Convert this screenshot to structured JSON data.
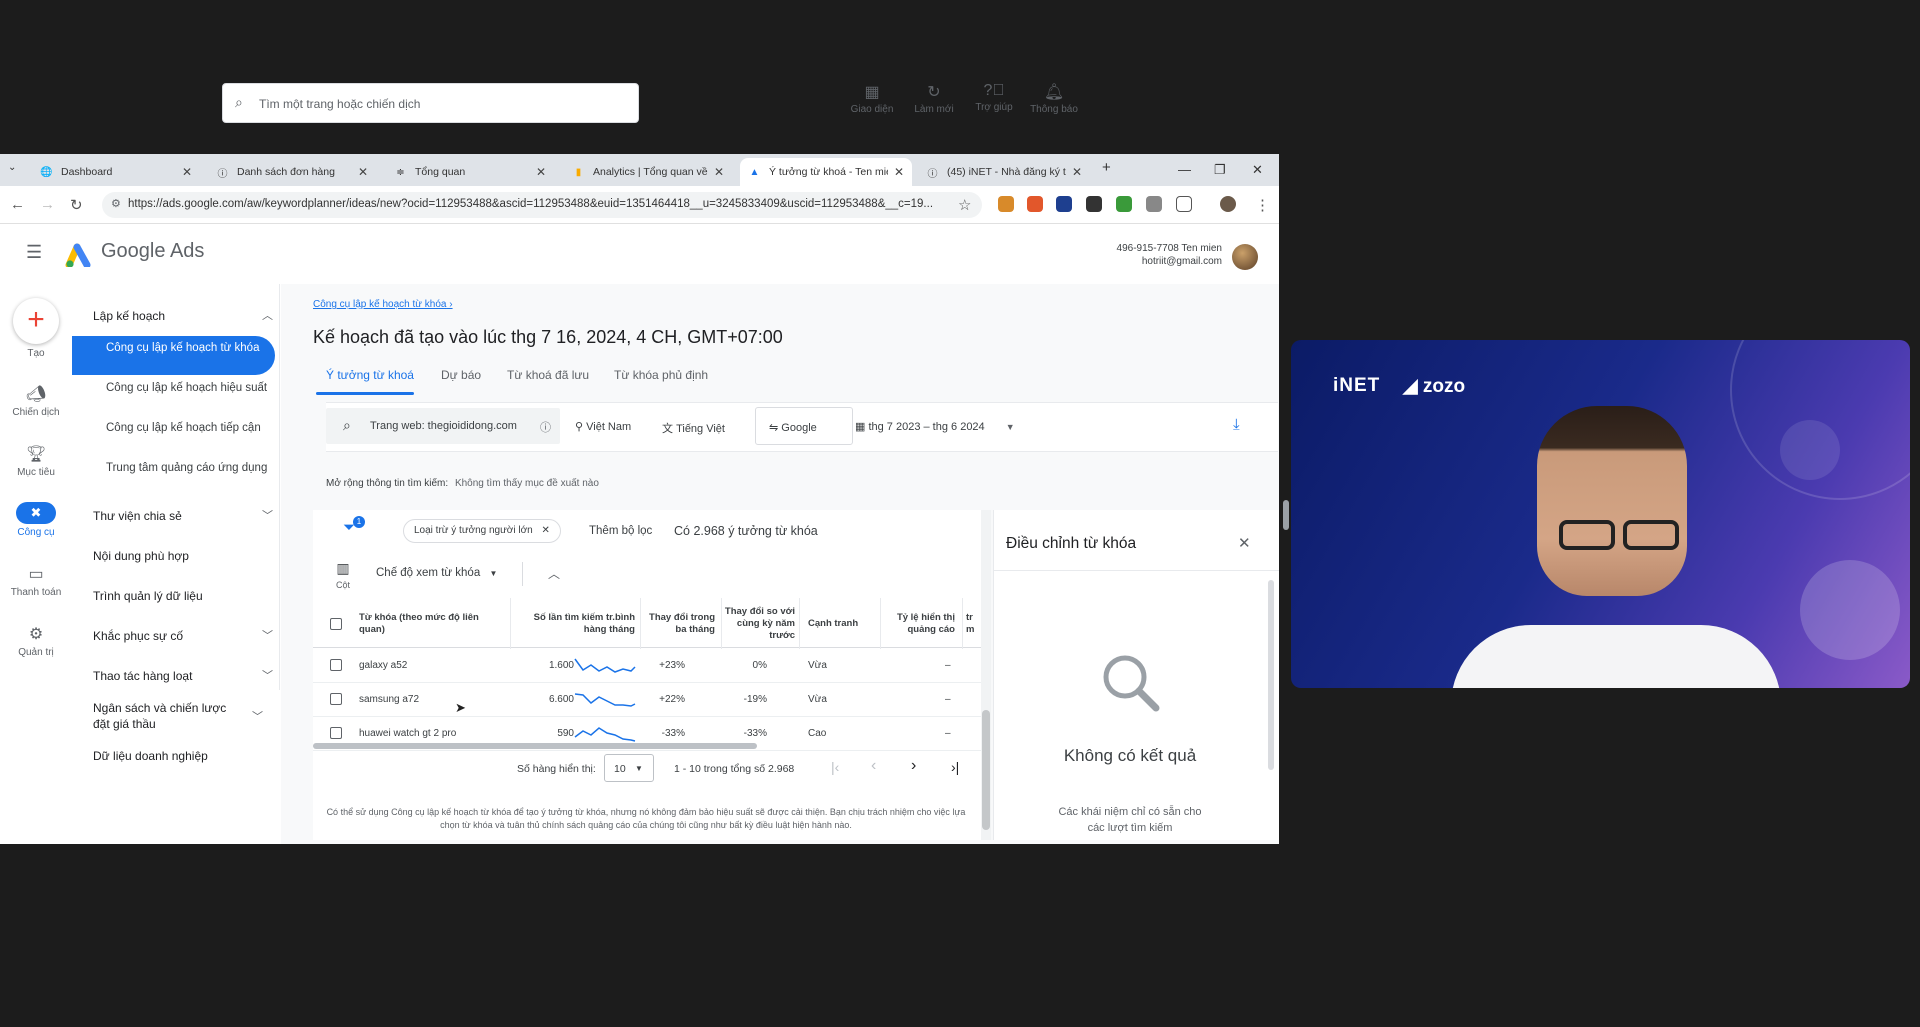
{
  "browser": {
    "tabs": [
      {
        "label": "Dashboard",
        "icon": "globe-icon"
      },
      {
        "label": "Danh sách đơn hàng",
        "icon": "info-icon"
      },
      {
        "label": "Tổng quan",
        "icon": "tune-icon"
      },
      {
        "label": "Analytics | Tổng quan về h",
        "icon": "analytics-icon"
      },
      {
        "label": "Ý tưởng từ khoá - Ten mie",
        "icon": "google-ads-icon"
      },
      {
        "label": "(45) iNET - Nhà đăng ký t",
        "icon": "info-icon"
      }
    ],
    "url": "https://ads.google.com/aw/keywordplanner/ideas/new?ocid=112953488&ascid=112953488&euid=1351464418__u=3245833409&uscid=112953488&__c=19..."
  },
  "header": {
    "product": "Google Ads",
    "search_placeholder": "Tìm một trang hoặc chiến dịch",
    "actions": [
      "Giao diện",
      "Làm mới",
      "Trợ giúp",
      "Thông báo"
    ],
    "account_id": "496-915-7708 Ten mien",
    "account_email": "hotriit@gmail.com"
  },
  "rail": [
    "Tạo",
    "Chiến dịch",
    "Mục tiêu",
    "Công cụ",
    "Thanh toán",
    "Quản trị"
  ],
  "sidenav": {
    "planning": "Lập kế hoạch",
    "sub": [
      "Công cụ lập kế hoạch từ khóa",
      "Công cụ lập kế hoạch hiệu suất",
      "Công cụ lập kế hoạch tiếp cận",
      "Trung tâm quảng cáo ứng dụng"
    ],
    "sections": [
      "Thư viện chia sẻ",
      "Nội dung phù hợp",
      "Trình quản lý dữ liệu",
      "Khắc phục sự cố",
      "Thao tác hàng loạt",
      "Ngân sách và chiến lược đặt giá thầu",
      "Dữ liệu doanh nghiệp"
    ]
  },
  "main": {
    "breadcrumb": "Công cụ lập kế hoạch từ khóa",
    "title": "Kế hoạch đã tạo vào lúc thg 7 16, 2024, 4 CH, GMT+07:00",
    "tabs": [
      "Ý tưởng từ khoá",
      "Dự báo",
      "Từ khoá đã lưu",
      "Từ khóa phủ định"
    ],
    "filters": {
      "website": "Trang web: thegioididong.com",
      "location": "Việt Nam",
      "language": "Tiếng Việt",
      "network": "Google",
      "date_range": "thg 7 2023 – thg 6 2024"
    },
    "expand_label": "Mở rộng thông tin tìm kiếm:",
    "expand_value": "Không tìm thấy mục đề xuất nào",
    "filter_badge": "1",
    "exclude_chip": "Loại trừ ý tưởng người lớn",
    "add_filter": "Thêm bộ lọc",
    "count": "Có 2.968 ý tưởng từ khóa",
    "view_mode": "Chế độ xem từ khóa",
    "columns_label": "Cột",
    "table": {
      "headers": [
        "Từ khóa (theo mức độ liên quan)",
        "Số lần tìm kiếm tr.bình hàng tháng",
        "Thay đổi trong ba tháng",
        "Thay đổi so với cùng kỳ năm trước",
        "Cạnh tranh",
        "Tỷ lệ hiển thị quảng cáo",
        "tr m"
      ],
      "rows": [
        {
          "keyword": "galaxy a52",
          "searches": "1.600",
          "three_month": "+23%",
          "yoy": "0%",
          "competition": "Vừa",
          "impr": "–"
        },
        {
          "keyword": "samsung a72",
          "searches": "6.600",
          "three_month": "+22%",
          "yoy": "-19%",
          "competition": "Vừa",
          "impr": "–"
        },
        {
          "keyword": "huawei watch gt 2 pro",
          "searches": "590",
          "three_month": "-33%",
          "yoy": "-33%",
          "competition": "Cao",
          "impr": "–"
        }
      ]
    },
    "pagination": {
      "rows_label": "Số hàng hiển thị:",
      "rows_value": "10",
      "range": "1 - 10 trong tổng số 2.968"
    },
    "disclaimer": "Có thể sử dụng Công cụ lập kế hoạch từ khóa để tạo ý tưởng từ khóa, nhưng nó không đảm bảo hiệu suất sẽ được cải thiện. Bạn chịu trách nhiệm cho việc lựa chọn từ khóa và tuân thủ chính sách quảng cáo của chúng tôi cũng như bất kỳ điều luật hiện hành nào."
  },
  "refine_panel": {
    "title": "Điều chỉnh từ khóa",
    "empty_title": "Không có kết quả",
    "empty_desc": "Các khái niệm chỉ có sẵn cho các lượt tìm kiếm"
  },
  "video": {
    "brand1": "iNET",
    "brand2": "zozo"
  },
  "colors": {
    "accent": "#1a73e8",
    "video_bg": "#1a2a8a"
  }
}
